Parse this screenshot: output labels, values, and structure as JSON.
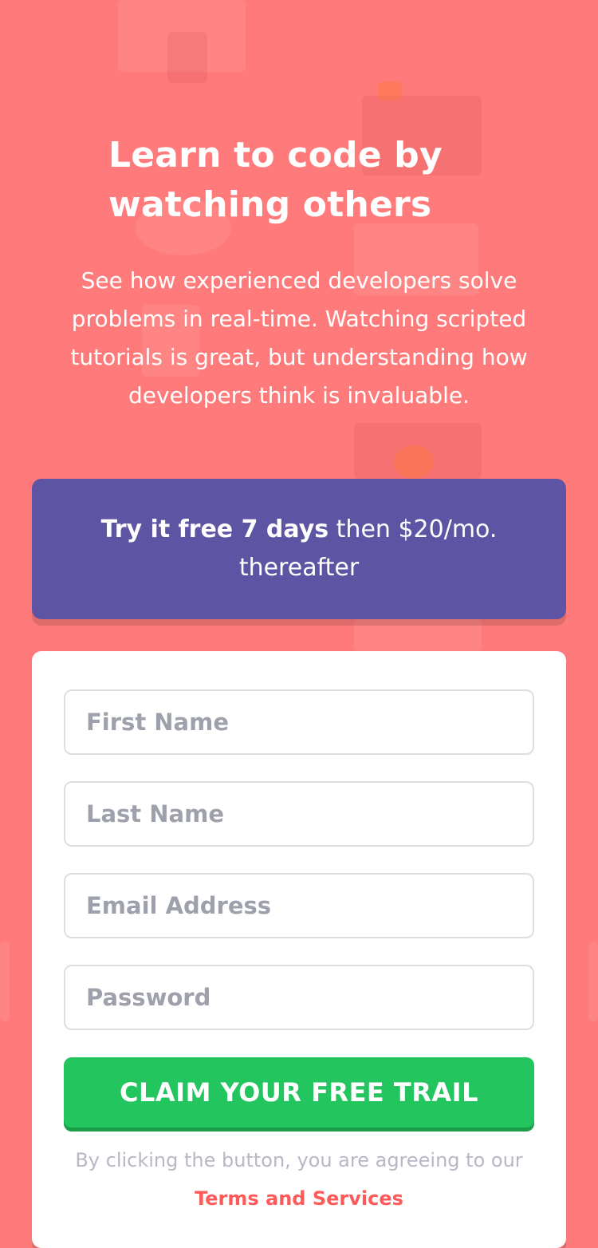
{
  "hero": {
    "title": "Learn to code by watching others",
    "description": "See how experienced developers solve problems in real-time. Watching scripted tutorials is great, but understanding how developers think is invaluable."
  },
  "offer": {
    "strong": "Try it free 7 days",
    "rest": " then $20/mo. thereafter"
  },
  "form": {
    "first_name_placeholder": "First Name",
    "last_name_placeholder": "Last Name",
    "email_placeholder": "Email Address",
    "password_placeholder": "Password",
    "submit_label": "CLAIM YOUR FREE TRAIL",
    "legal_text": "By clicking the button, you are agreeing to our",
    "terms_link": "Terms and Services"
  },
  "colors": {
    "background": "#ff7a7a",
    "banner": "#5e54a4",
    "button": "#22c55e",
    "link": "#ff5a5a"
  }
}
